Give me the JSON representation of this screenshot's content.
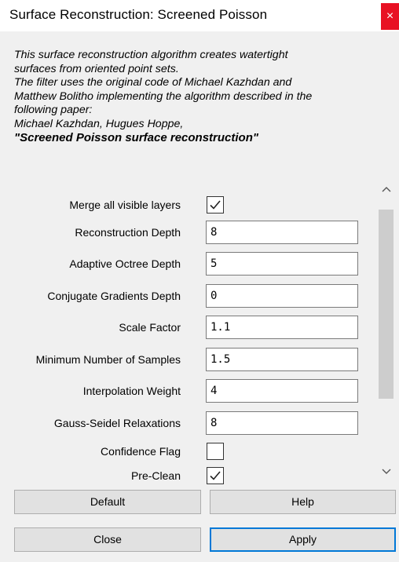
{
  "window": {
    "title": "Surface Reconstruction: Screened Poisson",
    "close_glyph": "×"
  },
  "description": {
    "lines": [
      "This surface reconstruction algorithm creates watertight",
      "surfaces from oriented point sets.",
      "The filter uses the original code of Michael Kazhdan and",
      "Matthew Bolitho implementing the algorithm described in the",
      "following paper:",
      "Michael Kazhdan, Hugues Hoppe,"
    ],
    "paper_title": "\"Screened Poisson surface reconstruction\""
  },
  "params": {
    "merge_layers": {
      "label": "Merge all visible layers",
      "checked": true
    },
    "reconstruction_depth": {
      "label": "Reconstruction Depth",
      "value": "8"
    },
    "adaptive_octree_depth": {
      "label": "Adaptive Octree Depth",
      "value": "5"
    },
    "conjugate_gradients_depth": {
      "label": "Conjugate Gradients Depth",
      "value": "0"
    },
    "scale_factor": {
      "label": "Scale Factor",
      "value": "1.1"
    },
    "min_samples": {
      "label": "Minimum Number of Samples",
      "value": "1.5"
    },
    "interpolation_weight": {
      "label": "Interpolation Weight",
      "value": "4"
    },
    "gauss_seidel": {
      "label": "Gauss-Seidel Relaxations",
      "value": "8"
    },
    "confidence_flag": {
      "label": "Confidence Flag",
      "checked": false
    },
    "pre_clean": {
      "label": "Pre-Clean",
      "checked": true
    }
  },
  "scrollbar": {
    "up_icon": "chevron-up-icon",
    "down_icon": "chevron-down-icon"
  },
  "buttons": {
    "default": "Default",
    "help": "Help",
    "close": "Close",
    "apply": "Apply"
  },
  "colors": {
    "close_red": "#e81123",
    "focus_blue": "#0078d7",
    "dialog_bg": "#f0f0f0"
  }
}
